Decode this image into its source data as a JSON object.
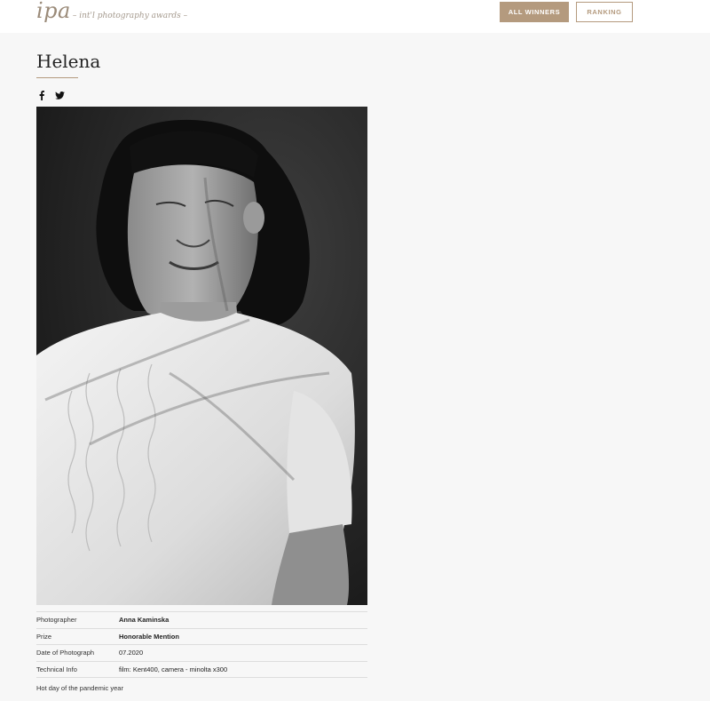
{
  "header": {
    "logo_mark": "ipa",
    "logo_tagline": "– int'l photography awards –",
    "all_winners_label": "ALL WINNERS",
    "ranking_label": "RANKING"
  },
  "page": {
    "title": "Helena"
  },
  "share": {
    "facebook_icon": "facebook-icon",
    "twitter_icon": "twitter-icon"
  },
  "photo": {
    "style": "black-and-white portrait"
  },
  "details": [
    {
      "label": "Photographer",
      "value": "Anna Kaminska"
    },
    {
      "label": "Prize",
      "value": "Honorable Mention"
    },
    {
      "label": "Date of Photograph",
      "value": "07.2020"
    },
    {
      "label": "Technical Info",
      "value": "film: Kent400, camera - minolta x300"
    }
  ],
  "caption": "Hot day of the pandemic year",
  "colors": {
    "accent": "#b49a7e",
    "background": "#f7f7f7"
  }
}
